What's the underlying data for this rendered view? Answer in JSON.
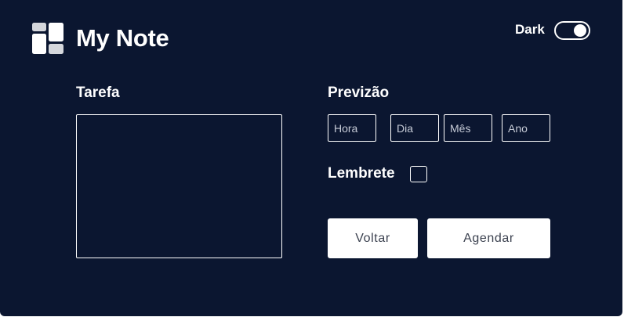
{
  "app": {
    "title": "My Note",
    "logo_icon": "dashboard-grid-icon"
  },
  "theme": {
    "label": "Dark",
    "dark_mode_on": true,
    "background_color": "#0b1630",
    "foreground_color": "#ffffff"
  },
  "task": {
    "label": "Tarefa",
    "value": ""
  },
  "forecast": {
    "label": "Previzão",
    "fields": {
      "hora": {
        "placeholder": "Hora",
        "value": ""
      },
      "dia": {
        "placeholder": "Dia",
        "value": ""
      },
      "mes": {
        "placeholder": "Mês",
        "value": ""
      },
      "ano": {
        "placeholder": "Ano",
        "value": ""
      }
    }
  },
  "reminder": {
    "label": "Lembrete",
    "checked": false
  },
  "actions": {
    "back_label": "Voltar",
    "schedule_label": "Agendar"
  }
}
